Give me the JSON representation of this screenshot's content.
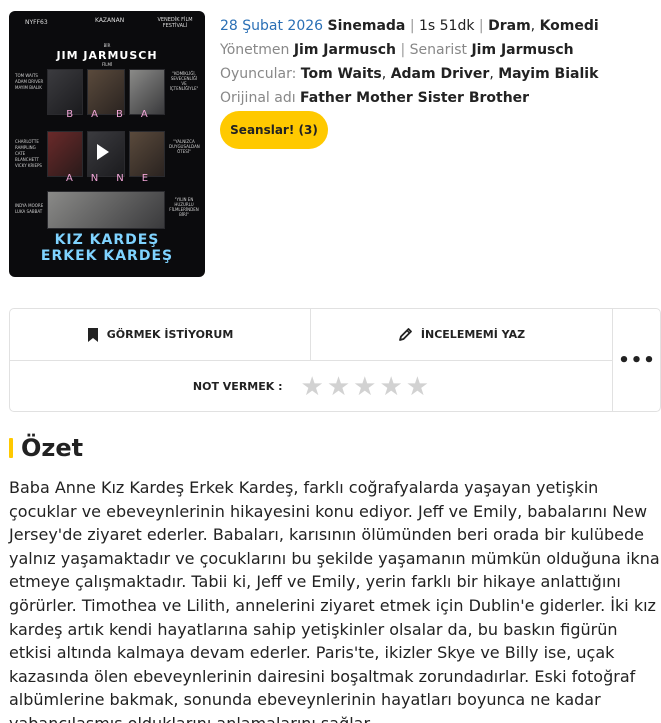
{
  "poster": {
    "badge_left": "NYFF63",
    "badge_mid": "KAZANAN",
    "badge_right": "VENEDİK FİLM FESTİVALİ",
    "director_pre": "BİR",
    "director_name": "JIM JARMUSCH",
    "director_post": "FİLMİ",
    "word_top": "BABA",
    "word_bottom": "ANNE",
    "title_line1": "KIZ KARDEŞ",
    "title_line2": "ERKEK KARDEŞ",
    "cast_row1": [
      "TOM WAITS",
      "ADAM DRIVER",
      "MAYIM BIALIK"
    ],
    "cast_row2": [
      "CHARLOTTE RAMPLING",
      "CATE BLANCHETT",
      "VICKY KRIEPS"
    ],
    "cast_row3": [
      "INDYA MOORE",
      "LUKA SABBAT"
    ],
    "quote1": "\"KOMİKLİĞİ, SEVECENLİĞİ VE İÇTENLİĞİYLE\"",
    "quote2": "\"YALNIZCA DUYGUSALDAN ÖTESİ\"",
    "quote3": "\"YILIN EN HUZURLU FİLMLERİNDEN BİRİ\""
  },
  "info": {
    "date": "28 Şubat 2026",
    "status": "Sinemada",
    "duration": "1s 51dk",
    "genre1": "Dram",
    "genre2": "Komedi",
    "director_label": "Yönetmen",
    "director": "Jim Jarmusch",
    "writer_label": "Senarist",
    "writer": "Jim Jarmusch",
    "cast_label": "Oyuncular:",
    "cast1": "Tom Waits",
    "cast2": "Adam Driver",
    "cast3": "Mayim Bialik",
    "original_label": "Orijinal adı",
    "original_title": "Father Mother Sister Brother",
    "sessions_button": "Seanslar! (3)"
  },
  "actions": {
    "watchlist_label": "GÖRMEK İSTİYORUM",
    "review_label": "İNCELEMEMİ YAZ",
    "rate_label": "NOT VERMEK :",
    "more_label": "•••",
    "stars": [
      "★",
      "★",
      "★",
      "★",
      "★"
    ]
  },
  "summary": {
    "title": "Özet",
    "text": "Baba Anne Kız Kardeş Erkek Kardeş, farklı coğrafyalarda yaşayan yetişkin çocuklar ve ebeveynlerinin hikayesini konu ediyor. Jeff ve Emily, babalarını New Jersey'de ziyaret ederler. Babaları, karısının ölümünden beri orada bir kulübede yalnız yaşamaktadır ve çocuklarını bu şekilde yaşamanın mümkün olduğuna ikna etmeye çalışmaktadır. Tabii ki, Jeff ve Emily, yerin farklı bir hikaye anlattığını görürler. Timothea ve Lilith, annelerini ziyaret etmek için Dublin'e giderler. İki kız kardeş artık kendi hayatlarına sahip yetişkinler olsalar da, bu baskın figürün etkisi altında kalmaya devam ederler. Paris'te, ikizler Skye ve Billy ise, uçak kazasında ölen ebeveynlerinin dairesini boşaltmak zorundadırlar. Eski fotoğraf albümlerine bakmak, sonunda ebeveynlerinin hayatları boyunca ne kadar yabancılaşmış olduklarını anlamalarını sağlar..."
  },
  "colors": {
    "accent_yellow": "#ffc900",
    "link_blue": "#2a6fb5",
    "poster_title_blue": "#7fd3ff",
    "poster_word_pink": "#f2a6d8"
  }
}
